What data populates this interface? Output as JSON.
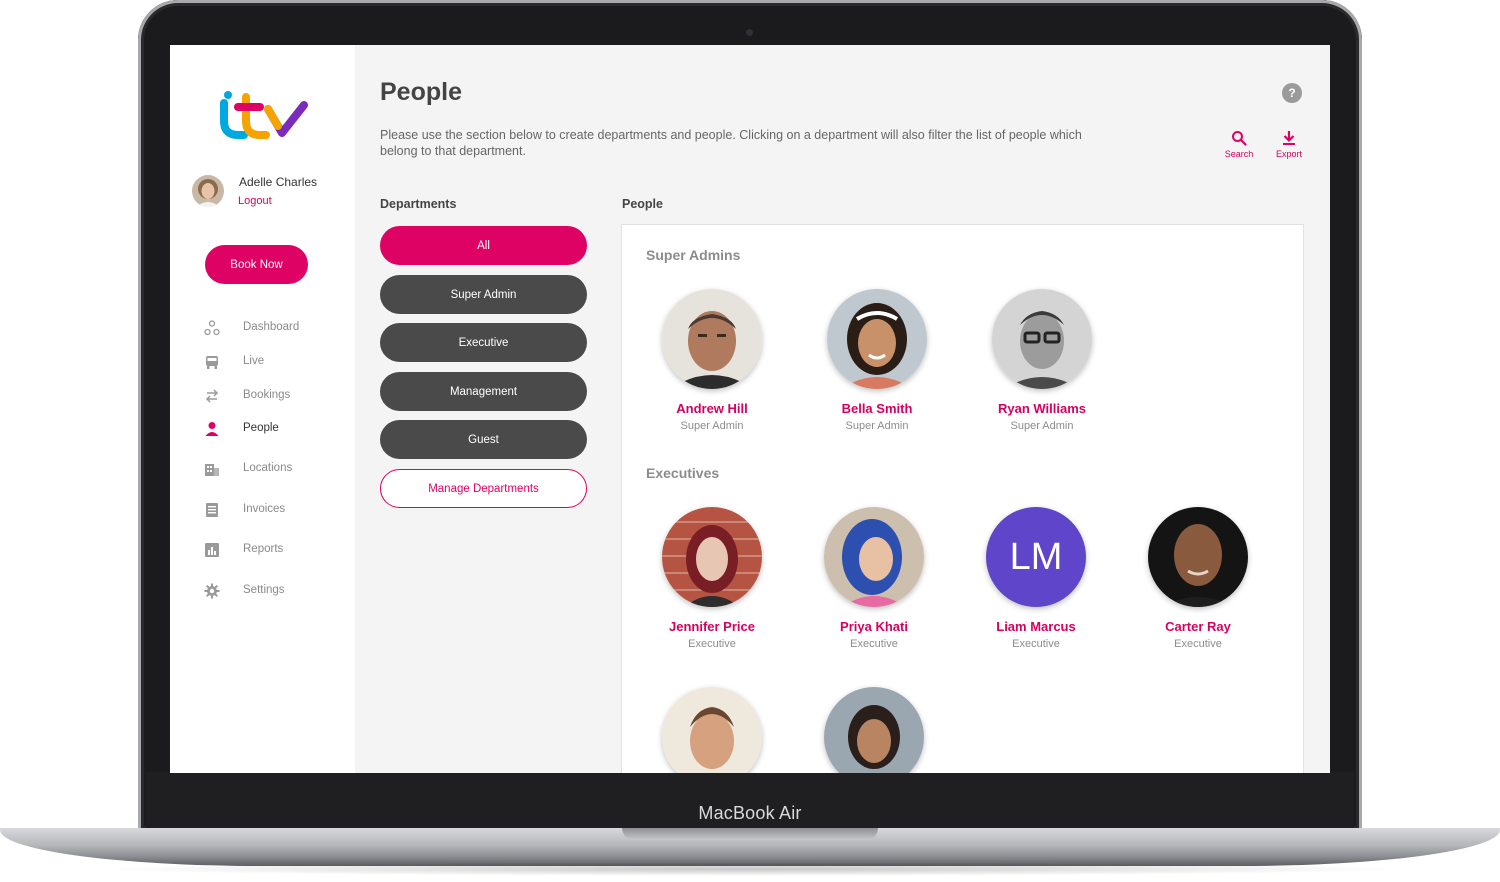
{
  "device": {
    "label": "MacBook Air"
  },
  "brand": {
    "logo_text": "itv",
    "accent": "#dd0264",
    "logo_colors": [
      "#00a8e1",
      "#f5a300",
      "#dd0264",
      "#7a2bbd"
    ]
  },
  "user": {
    "name": "Adelle Charles",
    "logout_label": "Logout"
  },
  "sidebar": {
    "book_now_label": "Book Now",
    "items": [
      {
        "label": "Dashboard",
        "icon": "dashboard-icon",
        "active": false
      },
      {
        "label": "Live",
        "icon": "live-icon",
        "active": false
      },
      {
        "label": "Bookings",
        "icon": "bookings-icon",
        "active": false
      },
      {
        "label": "People",
        "icon": "people-icon",
        "active": true
      },
      {
        "label": "Locations",
        "icon": "locations-icon",
        "active": false
      },
      {
        "label": "Invoices",
        "icon": "invoices-icon",
        "active": false
      },
      {
        "label": "Reports",
        "icon": "reports-icon",
        "active": false
      },
      {
        "label": "Settings",
        "icon": "settings-icon",
        "active": false
      }
    ]
  },
  "header": {
    "title": "People",
    "help_icon": "?",
    "intro": "Please use the section below to create departments and people. Clicking on a department will also filter the list of people which belong to that department.",
    "search_label": "Search",
    "export_label": "Export"
  },
  "departments": {
    "heading": "Departments",
    "items": [
      {
        "label": "All",
        "active": true
      },
      {
        "label": "Super Admin",
        "active": false
      },
      {
        "label": "Executive",
        "active": false
      },
      {
        "label": "Management",
        "active": false
      },
      {
        "label": "Guest",
        "active": false
      }
    ],
    "manage_label": "Manage Departments"
  },
  "people": {
    "heading": "People",
    "groups": [
      {
        "title": "Super Admins",
        "members": [
          {
            "name": "Andrew Hill",
            "role": "Super Admin"
          },
          {
            "name": "Bella Smith",
            "role": "Super Admin"
          },
          {
            "name": "Ryan Williams",
            "role": "Super Admin"
          }
        ]
      },
      {
        "title": "Executives",
        "members": [
          {
            "name": "Jennifer Price",
            "role": "Executive"
          },
          {
            "name": "Priya Khati",
            "role": "Executive"
          },
          {
            "name": "Liam Marcus",
            "role": "Executive",
            "initials": "LM"
          },
          {
            "name": "Carter Ray",
            "role": "Executive"
          }
        ]
      }
    ]
  }
}
